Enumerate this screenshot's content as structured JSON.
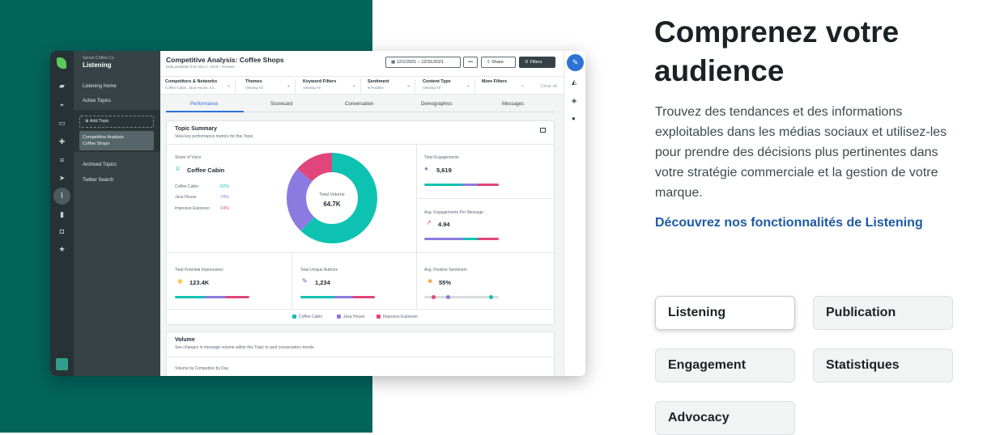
{
  "sidebar": {
    "org": "Sprout Coffee Co.",
    "title": "Listening",
    "links": [
      "Listening Home",
      "Active Topics",
      "Archived Topics",
      "Twitter Search"
    ],
    "add_topic": "Add Topic",
    "topic_line1": "Competitive Analysis",
    "topic_line2": "Coffee Shops"
  },
  "header": {
    "title": "Competitive Analysis: Coffee Shops",
    "subtitle": "Data available from Dec 1, 2018 – Present",
    "date_range": "12/1/2021 – 12/31/2021",
    "more": "•••",
    "share": "Share",
    "filters": "Filters"
  },
  "filterbar": {
    "items": [
      {
        "label": "Competitors & Networks",
        "value": "Coffee Cabin, Java House, Im..."
      },
      {
        "label": "Themes",
        "value": "Viewing All"
      },
      {
        "label": "Keyword Filters",
        "value": "Viewing All"
      },
      {
        "label": "Sentiment",
        "value": "Positive"
      },
      {
        "label": "Content Type",
        "value": "Viewing All"
      },
      {
        "label": "More Filters",
        "value": ""
      }
    ],
    "clear": "Clear all"
  },
  "tabs": [
    "Performance",
    "Scorecard",
    "Conversation",
    "Demographics",
    "Messages"
  ],
  "topic_summary": {
    "title": "Topic Summary",
    "subtitle": "View key performance metrics for this Topic.",
    "share_of_voice_label": "Share of Voice",
    "leader": "Coffee Cabin",
    "rows": [
      {
        "name": "Coffee Cabin",
        "value": "62%"
      },
      {
        "name": "Java House",
        "value": "24%"
      },
      {
        "name": "Impresso Espresso",
        "value": "14%"
      }
    ],
    "donut_label": "Total Volume",
    "donut_value": "64.7K",
    "total_engagements_label": "Total Engagements",
    "total_engagements": "5,619",
    "avg_eng_label": "Avg. Engagements Per Message",
    "avg_eng": "4.94",
    "impressions_label": "Total Potential Impressions",
    "impressions": "123.4K",
    "authors_label": "Total Unique Authors",
    "authors": "1,234",
    "sentiment_label": "Avg. Positive Sentiment",
    "sentiment": "55%",
    "legend": [
      "Coffee Cabin",
      "Java House",
      "Impresso Espresso"
    ]
  },
  "volume": {
    "title": "Volume",
    "subtitle": "See changes in message volume within this Topic to spot conversation trends.",
    "sub2": "Volume by Competitor by Day"
  },
  "colors": {
    "coffee_cabin": "#0ec2b2",
    "java_house": "#8b7be0",
    "impresso": "#e0457b",
    "teal_bg": "#03645b",
    "link": "#1e5ba6"
  },
  "donut_shares": [
    0.62,
    0.24,
    0.14
  ],
  "marketing": {
    "headline": "Comprenez votre audience",
    "description": "Trouvez des tendances et des informations exploitables dans les médias sociaux et utilisez-les pour prendre des décisions plus pertinentes dans votre stratégie commerciale et la gestion de votre marque.",
    "cta": "Découvrez nos fonctionnalités de Listening",
    "pills": [
      "Listening",
      "Publication",
      "Engagement",
      "Statistiques",
      "Advocacy"
    ]
  }
}
